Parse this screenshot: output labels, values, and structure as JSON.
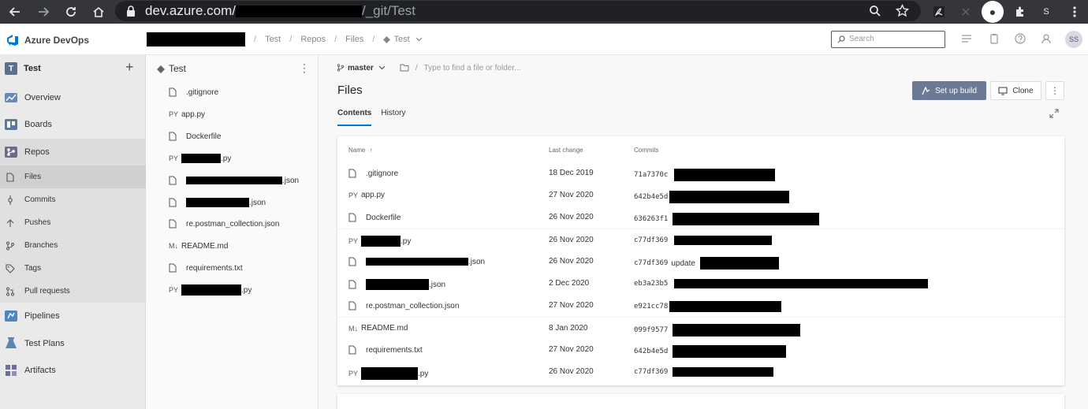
{
  "browser": {
    "url_host": "dev.azure.com/",
    "url_path": "/_git/Test",
    "profile_initial": "S"
  },
  "header": {
    "brand": "Azure DevOps",
    "breadcrumbs": [
      "Test",
      "Repos",
      "Files",
      "Test"
    ],
    "search_placeholder": "Search",
    "avatar_initials": "SS"
  },
  "sidebar": {
    "project_initial": "T",
    "project_name": "Test",
    "add_label": "+",
    "items": [
      {
        "label": "Overview"
      },
      {
        "label": "Boards"
      },
      {
        "label": "Repos"
      },
      {
        "label": "Pipelines"
      },
      {
        "label": "Test Plans"
      },
      {
        "label": "Artifacts"
      }
    ],
    "repo_items": [
      {
        "label": "Files"
      },
      {
        "label": "Commits"
      },
      {
        "label": "Pushes"
      },
      {
        "label": "Branches"
      },
      {
        "label": "Tags"
      },
      {
        "label": "Pull requests"
      }
    ]
  },
  "tree": {
    "repo_name": "Test",
    "items": [
      {
        "prefix": "",
        "name": ".gitignore"
      },
      {
        "prefix": "PY",
        "name": "app.py"
      },
      {
        "prefix": "",
        "name": "Dockerfile"
      },
      {
        "prefix": "PY",
        "name": ".py"
      },
      {
        "prefix": "",
        "name": ".json"
      },
      {
        "prefix": "",
        "name": ".json"
      },
      {
        "prefix": "",
        "name": "re.postman_collection.json"
      },
      {
        "prefix": "M↓",
        "name": "README.md"
      },
      {
        "prefix": "",
        "name": "requirements.txt"
      },
      {
        "prefix": "PY",
        "name": ".py"
      }
    ]
  },
  "main": {
    "branch": "master",
    "path_placeholder": "Type to find a file or folder...",
    "title": "Files",
    "setup_build_label": "Set up build",
    "clone_label": "Clone",
    "tabs": [
      {
        "label": "Contents"
      },
      {
        "label": "History"
      }
    ],
    "columns": {
      "name": "Name",
      "last_change": "Last change",
      "commits": "Commits"
    },
    "files": [
      {
        "prefix": "",
        "name": ".gitignore",
        "date": "18 Dec 2019",
        "commit": "71a7370c",
        "message": ""
      },
      {
        "prefix": "PY",
        "name": "app.py",
        "date": "27 Nov 2020",
        "commit": "642b4e5d",
        "message": ""
      },
      {
        "prefix": "",
        "name": "Dockerfile",
        "date": "26 Nov 2020",
        "commit": "636263f1",
        "message": ""
      },
      {
        "prefix": "PY",
        "name": ".py",
        "date": "26 Nov 2020",
        "commit": "c77df369",
        "message": ""
      },
      {
        "prefix": "",
        "name": ".json",
        "date": "26 Nov 2020",
        "commit": "c77df369",
        "message": "update"
      },
      {
        "prefix": "",
        "name": ".json",
        "date": "2 Dec 2020",
        "commit": "eb3a23b5",
        "message": ""
      },
      {
        "prefix": "",
        "name": "re.postman_collection.json",
        "date": "27 Nov 2020",
        "commit": "e921cc78",
        "message": ""
      },
      {
        "prefix": "M↓",
        "name": "README.md",
        "date": "8 Jan 2020",
        "commit": "099f9577",
        "message": ""
      },
      {
        "prefix": "",
        "name": "requirements.txt",
        "date": "27 Nov 2020",
        "commit": "642b4e5d",
        "message": ""
      },
      {
        "prefix": "PY",
        "name": ".py",
        "date": "26 Nov 2020",
        "commit": "c77df369",
        "message": ""
      }
    ]
  },
  "colors": {
    "accent": "#0078d4",
    "build_button": "#6b7b95",
    "chrome_dark": "#35363a"
  }
}
